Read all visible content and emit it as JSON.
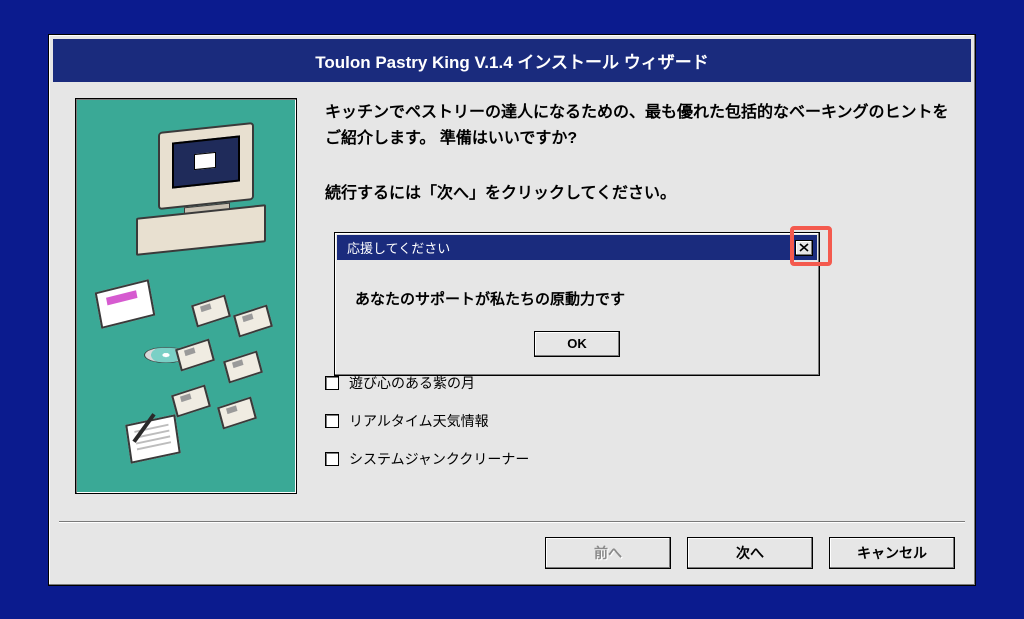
{
  "wizard": {
    "title": "Toulon Pastry King V.1.4 インストール ウィザード",
    "intro_line": "キッチンでペストリーの達人になるための、最も優れた包括的なベーキングのヒントをご紹介します。 準備はいいですか?",
    "continue_line": "続行するには「次へ」をクリックしてください。",
    "checks": [
      "遊び心のある紫の月",
      "リアルタイム天気情報",
      "システムジャンククリーナー"
    ],
    "buttons": {
      "back": "前へ",
      "next": "次へ",
      "cancel": "キャンセル"
    }
  },
  "dialog": {
    "title": "応援してください",
    "body": "あなたのサポートが私たちの原動力です",
    "ok": "OK"
  }
}
